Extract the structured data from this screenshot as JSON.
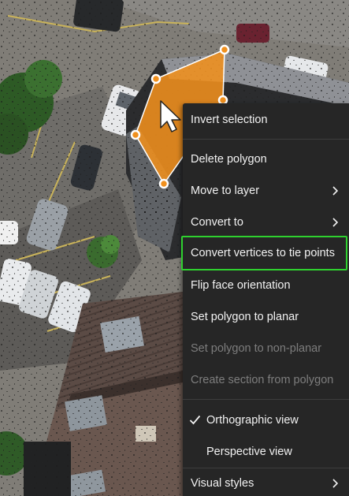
{
  "context_menu": {
    "items": [
      {
        "label": "Invert selection"
      },
      {
        "label": "Delete polygon"
      },
      {
        "label": "Move to layer"
      },
      {
        "label": "Convert to"
      },
      {
        "label": "Convert vertices to tie points"
      },
      {
        "label": "Flip face orientation"
      },
      {
        "label": "Set polygon to planar"
      },
      {
        "label": "Set polygon to non-planar"
      },
      {
        "label": "Create section from polygon"
      },
      {
        "label": "Orthographic view"
      },
      {
        "label": "Perspective view"
      },
      {
        "label": "Visual styles"
      }
    ]
  },
  "icons": {
    "submenu": "chevron-right-icon",
    "checked": "checkmark-icon",
    "pointer": "mouse-cursor-icon"
  },
  "colors": {
    "polygon_fill": "#f0901e",
    "polygon_vertex": "#ffffff",
    "menu_background": "#262626",
    "menu_text": "#f2f2f2",
    "menu_disabled_text": "#7d7d7d",
    "highlight_border": "#2fd12f"
  }
}
